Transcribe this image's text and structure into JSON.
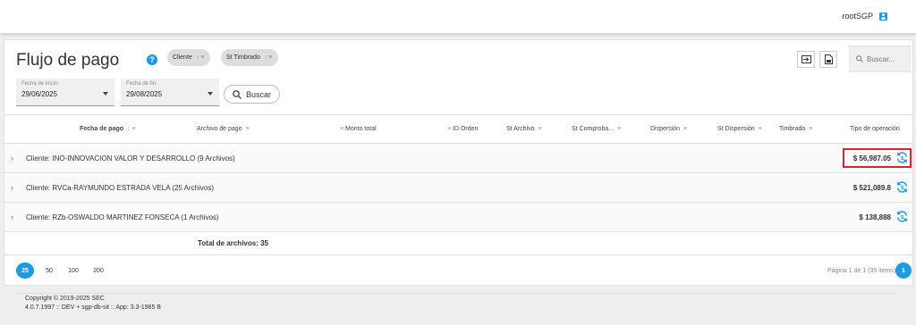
{
  "topbar": {
    "username": "rootSGP"
  },
  "page": {
    "title": "Flujo de pago",
    "help": "?",
    "chips": [
      {
        "label": "Cliente"
      },
      {
        "label": "St Timbrado"
      }
    ],
    "search_placeholder": "Buscar..."
  },
  "filters": {
    "start_label": "Fecha de inicio:",
    "start_value": "29/06/2025",
    "end_label": "Fecha de fin:",
    "end_value": "29/08/2025",
    "search_button": "Buscar"
  },
  "table": {
    "columns": [
      "Fecha de pago",
      "Archivo de pago",
      "Monto total",
      "ID Orden",
      "St Archivo",
      "St Comproba...",
      "Dispersión",
      "St Dispersión",
      "Timbrado",
      "Tipo de operación"
    ],
    "groups": [
      {
        "label": "Cliente: INO-INNOVACION VALOR Y DESARROLLO (9 Archivos)",
        "amount": "$ 56,987.05"
      },
      {
        "label": "Cliente: RVCa-RAYMUNDO ESTRADA VELA (25 Archivos)",
        "amount": "$ 521,089.8"
      },
      {
        "label": "Cliente: RZb-OSWALDO MARTINEZ FONSECA (1 Archivos)",
        "amount": "$ 138,888"
      }
    ],
    "total": "Total de archivos: 35"
  },
  "pager": {
    "sizes": [
      "25",
      "50",
      "100",
      "200"
    ],
    "info": "Página 1 de 1 (35 items)",
    "current": "1"
  },
  "footer": {
    "copyright": "Copyright © 2019-2025 SEC",
    "version": "4.0.7.1997 :: DEV + sgp-db-sit :: App: 3.3-1985 B"
  },
  "colors": {
    "accent": "#1a9be6",
    "highlight": "#d9232e"
  }
}
